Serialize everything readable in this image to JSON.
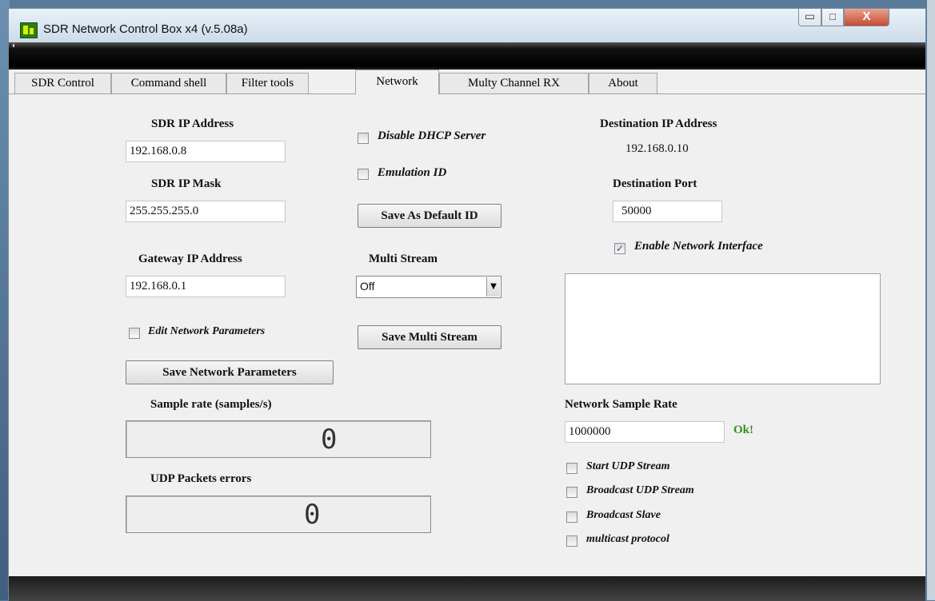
{
  "window": {
    "title": "SDR Network Control Box x4 (v.5.08a)",
    "minimize": "▭",
    "maximize": "□",
    "close": "X"
  },
  "tabs": [
    {
      "label": "SDR Control",
      "active": false
    },
    {
      "label": "Command shell",
      "active": false
    },
    {
      "label": "Filter tools",
      "active": false
    },
    {
      "label": "Network",
      "active": true
    },
    {
      "label": "Multy Channel RX",
      "active": false
    },
    {
      "label": "About",
      "active": false
    }
  ],
  "left": {
    "sdr_ip_label": "SDR IP Address",
    "sdr_ip_value": "192.168.0.8",
    "sdr_mask_label": "SDR IP Mask",
    "sdr_mask_value": "255.255.255.0",
    "gateway_label": "Gateway IP Address",
    "gateway_value": "192.168.0.1",
    "edit_params_label": "Edit Network Parameters",
    "edit_params_checked": false,
    "save_params_button": "Save Network Parameters",
    "sample_rate_label": "Sample rate (samples/s)",
    "sample_rate_value": "0",
    "udp_errors_label": "UDP Packets errors",
    "udp_errors_value": "0"
  },
  "middle": {
    "disable_dhcp_label": "Disable DHCP Server",
    "disable_dhcp_checked": false,
    "emulation_id_label": "Emulation ID",
    "emulation_id_checked": false,
    "save_default_id_button": "Save As Default ID",
    "multi_stream_label": "Multi Stream",
    "multi_stream_value": "Off",
    "save_multi_stream_button": "Save Multi Stream"
  },
  "right": {
    "dest_ip_label": "Destination IP Address",
    "dest_ip_value": "192.168.0.10",
    "dest_port_label": "Destination Port",
    "dest_port_value": "50000",
    "enable_network_label": "Enable Network Interface",
    "enable_network_checked": true,
    "network_sample_rate_label": "Network Sample Rate",
    "network_sample_rate_value": "1000000",
    "status_text": "Ok!",
    "start_udp_label": "Start UDP Stream",
    "broadcast_udp_label": "Broadcast UDP Stream",
    "broadcast_slave_label": "Broadcast Slave",
    "multicast_label": "multicast protocol"
  },
  "icons": {
    "check": "✓",
    "dropdown": "▼"
  },
  "colors": {
    "status_ok": "#3a8d1f",
    "close_button": "#c74b32"
  }
}
